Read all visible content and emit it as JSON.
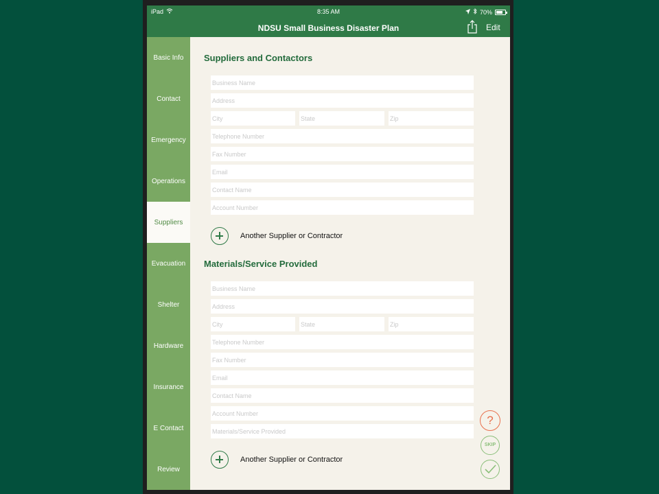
{
  "status_bar": {
    "device": "iPad",
    "time": "8:35 AM",
    "battery": "70%"
  },
  "navbar": {
    "title": "NDSU Small Business Disaster Plan",
    "edit_label": "Edit"
  },
  "sidebar": {
    "items": [
      {
        "label": "Basic Info"
      },
      {
        "label": "Contact"
      },
      {
        "label": "Emergency"
      },
      {
        "label": "Operations"
      },
      {
        "label": "Suppliers",
        "active": true
      },
      {
        "label": "Evacuation"
      },
      {
        "label": "Shelter"
      },
      {
        "label": "Hardware"
      },
      {
        "label": "Insurance"
      },
      {
        "label": "E Contact"
      },
      {
        "label": "Review"
      }
    ]
  },
  "suppliers": {
    "title": "Suppliers and Contactors",
    "placeholders": {
      "business_name": "Business Name",
      "address": "Address",
      "city": "City",
      "state": "State",
      "zip": "Zip",
      "telephone": "Telephone Number",
      "fax": "Fax Number",
      "email": "Email",
      "contact_name": "Contact Name",
      "account_number": "Account Number"
    },
    "add_label": "Another Supplier or Contractor"
  },
  "materials": {
    "title": "Materials/Service Provided",
    "placeholders": {
      "business_name": "Business Name",
      "address": "Address",
      "city": "City",
      "state": "State",
      "zip": "Zip",
      "telephone": "Telephone Number",
      "fax": "Fax Number",
      "email": "Email",
      "contact_name": "Contact Name",
      "account_number": "Account Number",
      "materials_service": "Materials/Service Provided"
    },
    "add_label": "Another Supplier or Contractor"
  },
  "actions": {
    "help": "?",
    "skip": "SKIP"
  },
  "colors": {
    "brand_green": "#2f7a47",
    "sidebar_green": "#7aa863",
    "help_orange": "#e86f4c",
    "accent_light_green": "#8bbf7a"
  }
}
